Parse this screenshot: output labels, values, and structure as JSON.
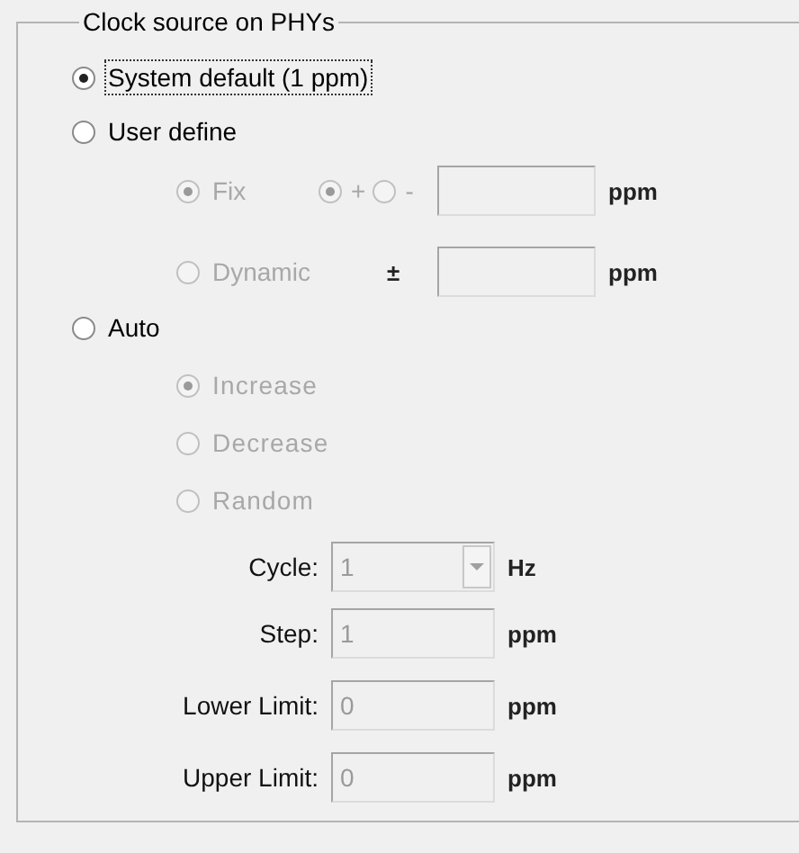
{
  "group_title": "Clock source on PHYs",
  "modes": [
    {
      "label": "System default (1 ppm)",
      "selected": true,
      "focused": true
    },
    {
      "label": "User define",
      "selected": false,
      "focused": false
    },
    {
      "label": "Auto",
      "selected": false,
      "focused": false
    }
  ],
  "user_define": {
    "disabled": true,
    "fix": {
      "label": "Fix",
      "selected": true,
      "signs": [
        {
          "label": "+",
          "selected": true
        },
        {
          "label": "-",
          "selected": false
        }
      ],
      "unit": "ppm"
    },
    "dynamic": {
      "label": "Dynamic",
      "selected": false,
      "symbol": "±",
      "unit": "ppm"
    }
  },
  "auto": {
    "disabled": true,
    "directions": [
      {
        "label": "Increase",
        "selected": true
      },
      {
        "label": "Decrease",
        "selected": false
      },
      {
        "label": "Random",
        "selected": false
      }
    ],
    "fields": [
      {
        "kind": "dropdown",
        "label": "Cycle:",
        "value": "1",
        "unit": "Hz"
      },
      {
        "kind": "text",
        "label": "Step:",
        "value": "1",
        "unit": "ppm"
      },
      {
        "kind": "text",
        "label": "Lower Limit:",
        "value": "0",
        "unit": "ppm"
      },
      {
        "kind": "text",
        "label": "Upper Limit:",
        "value": "0",
        "unit": "ppm"
      }
    ]
  }
}
